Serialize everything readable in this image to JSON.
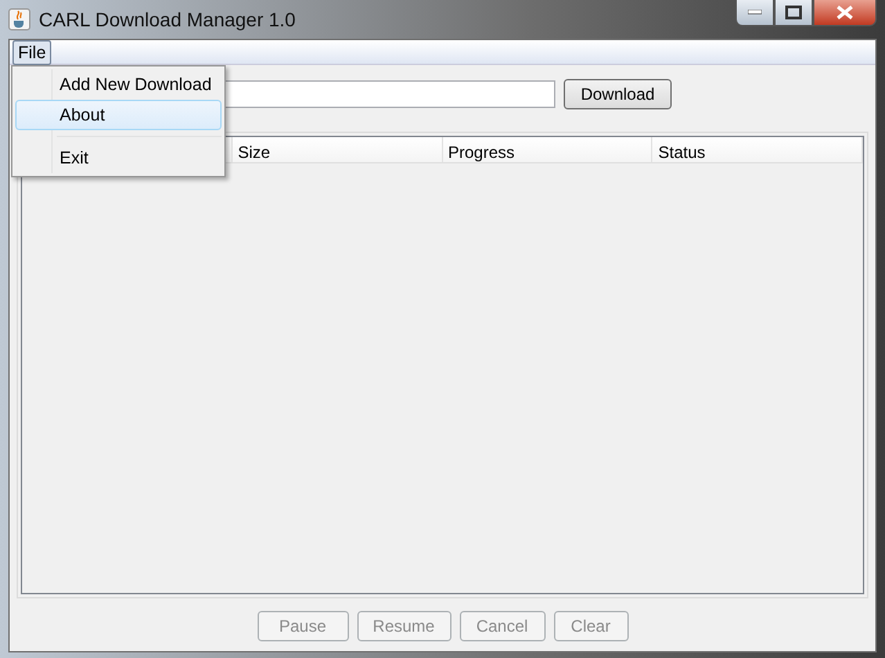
{
  "window": {
    "title": "CARL Download Manager 1.0"
  },
  "menu_bar": [
    {
      "label": "File",
      "selected": true
    }
  ],
  "file_menu": {
    "items": [
      {
        "kind": "item",
        "label": "Add New Download",
        "selected": false
      },
      {
        "kind": "item",
        "label": "About",
        "selected": true
      },
      {
        "kind": "separator"
      },
      {
        "kind": "item",
        "label": "Exit",
        "selected": false
      }
    ]
  },
  "download_button": {
    "label": "Download",
    "disabled": false
  },
  "table": {
    "columns": [
      "Size",
      "Progress",
      "Status"
    ]
  },
  "buttons": [
    {
      "label": "Pause",
      "disabled": true
    },
    {
      "label": "Resume",
      "disabled": true
    },
    {
      "label": "Cancel",
      "disabled": true
    },
    {
      "label": "Clear",
      "disabled": true
    }
  ]
}
